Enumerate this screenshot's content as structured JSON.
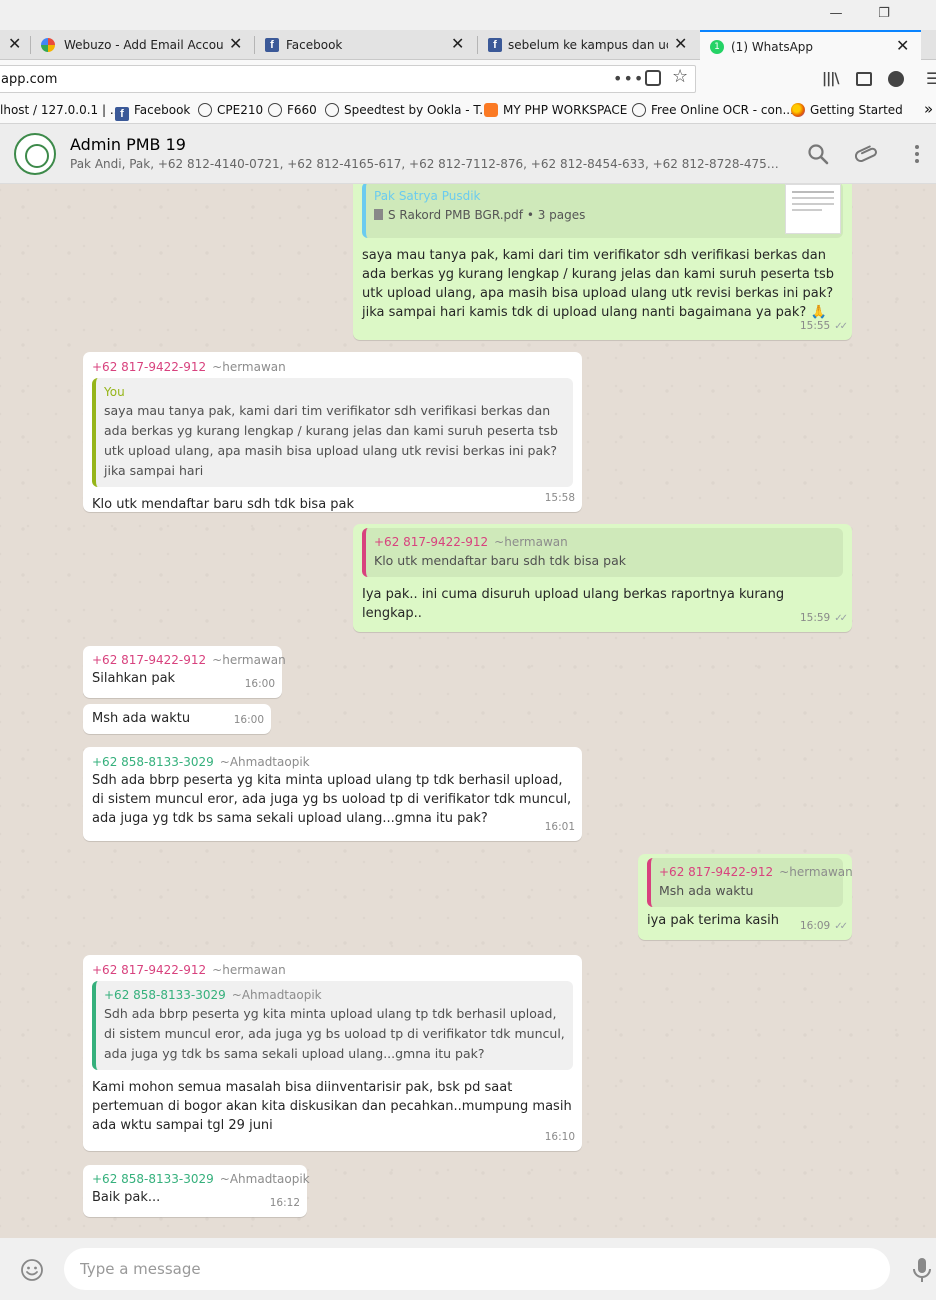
{
  "browser": {
    "tabs": [
      {
        "title": "Webuzo - Add Email Account"
      },
      {
        "title": "Facebook"
      },
      {
        "title": "sebelum ke kampus dan udah"
      },
      {
        "title": "(1) WhatsApp",
        "badge": "1"
      }
    ],
    "url": "app.com",
    "bookmarks": [
      {
        "label": "lhost / 127.0.0.1 | ..."
      },
      {
        "label": "Facebook",
        "icon": "facebook-icon"
      },
      {
        "label": "CPE210",
        "icon": "globe-icon"
      },
      {
        "label": "F660",
        "icon": "globe-icon"
      },
      {
        "label": "Speedtest by Ookla - T...",
        "icon": "globe-icon"
      },
      {
        "label": "MY PHP WORKSPACE",
        "icon": "xampp-icon"
      },
      {
        "label": "Free Online OCR - con...",
        "icon": "globe-icon"
      },
      {
        "label": "Getting Started",
        "icon": "firefox-icon"
      }
    ]
  },
  "chat": {
    "title": "Admin PMB 19",
    "participants": "Pak Andi, Pak, +62 812-4140-0721, +62 812-4165-617, +62 812-7112-876, +62 812-8454-633, +62 812-8728-475, +62 8...",
    "input_placeholder": "Type a message",
    "messages": [
      {
        "direction": "out",
        "quote_sender": "Pak Satrya Pusdik",
        "quote_file": "S Rakord PMB BGR.pdf • 3 pages",
        "text": "saya mau tanya pak,  kami dari tim verifikator sdh verifikasi berkas dan ada berkas yg kurang lengkap / kurang jelas dan kami suruh peserta tsb utk upload ulang, apa masih bisa upload ulang utk revisi berkas ini pak? jika sampai hari kamis tdk di upload ulang nanti bagaimana ya pak? 🙏",
        "time": "15:55"
      },
      {
        "direction": "in",
        "sender_number": "+62 817-9422-912",
        "sender_name": "~hermawan",
        "quote_sender": "You",
        "quote_text": "saya mau tanya pak,  kami dari tim verifikator sdh verifikasi berkas dan ada berkas yg kurang lengkap / kurang jelas dan kami suruh peserta tsb utk upload ulang, apa masih bisa upload ulang utk revisi berkas ini pak? jika sampai hari",
        "text": "Klo utk mendaftar baru sdh tdk bisa pak",
        "time": "15:58"
      },
      {
        "direction": "out",
        "quote_sender_number": "+62 817-9422-912",
        "quote_sender_name": "~hermawan",
        "quote_text": "Klo utk mendaftar baru sdh tdk bisa pak",
        "text": "Iya pak.. ini cuma disuruh upload ulang berkas raportnya kurang lengkap..",
        "time": "15:59"
      },
      {
        "direction": "in",
        "sender_number": "+62 817-9422-912",
        "sender_name": "~hermawan",
        "text": "Silahkan pak",
        "time": "16:00"
      },
      {
        "direction": "in",
        "text": "Msh ada waktu",
        "time": "16:00"
      },
      {
        "direction": "in",
        "sender_number": "+62 858-8133-3029",
        "sender_name": "~Ahmadtaopik",
        "text": "Sdh ada bbrp peserta yg kita minta upload ulang tp tdk berhasil upload, di sistem muncul eror, ada juga yg bs uoload tp di verifikator tdk muncul, ada juga yg tdk bs sama sekali upload ulang...gmna itu pak?",
        "time": "16:01"
      },
      {
        "direction": "out",
        "quote_sender_number": "+62 817-9422-912",
        "quote_sender_name": "~hermawan",
        "quote_text": "Msh ada waktu",
        "text": "iya pak terima kasih",
        "time": "16:09"
      },
      {
        "direction": "in",
        "sender_number": "+62 817-9422-912",
        "sender_name": "~hermawan",
        "quote_sender_number": "+62 858-8133-3029",
        "quote_sender_name": "~Ahmadtaopik",
        "quote_text": "Sdh ada bbrp peserta yg kita minta upload ulang tp tdk berhasil upload, di sistem muncul eror, ada juga yg bs uoload tp di verifikator tdk muncul, ada juga yg tdk bs sama sekali upload ulang...gmna itu pak?",
        "text": "Kami mohon semua masalah bisa diinventarisir pak, bsk pd saat pertemuan di bogor akan kita diskusikan dan pecahkan..mumpung masih ada wktu sampai tgl 29 juni",
        "time": "16:10"
      },
      {
        "direction": "in",
        "sender_number": "+62 858-8133-3029",
        "sender_name": "~Ahmadtaopik",
        "text": "Baik pak...",
        "time": "16:12"
      }
    ]
  },
  "colors": {
    "chat_bg": "#e5ddd5",
    "bubble_out": "#dcf8c6",
    "bubble_in": "#ffffff",
    "sender_pink": "#d8427e",
    "sender_green": "#35b07c"
  }
}
